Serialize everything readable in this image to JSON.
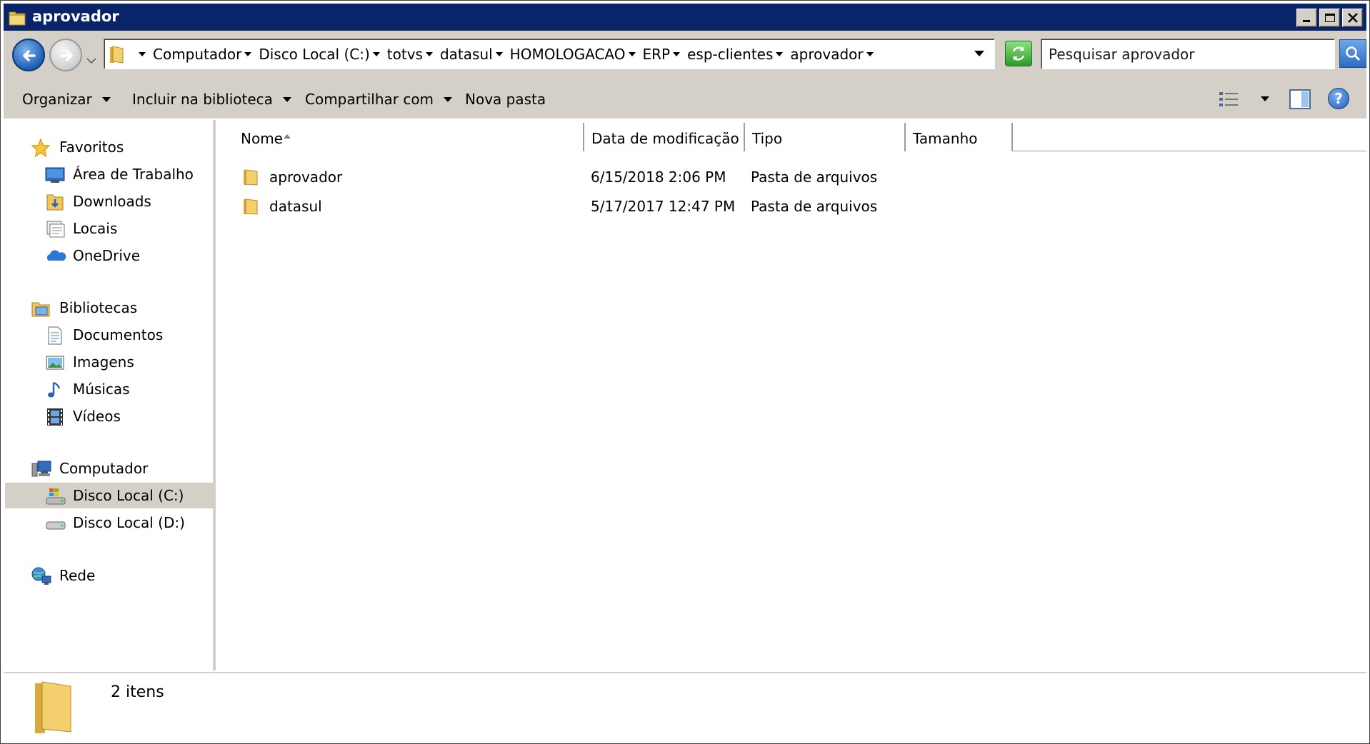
{
  "window": {
    "title": "aprovador"
  },
  "address": {
    "breadcrumbs": [
      "Computador",
      "Disco Local (C:)",
      "totvs",
      "datasul",
      "HOMOLOGACAO",
      "ERP",
      "esp-clientes",
      "aprovador"
    ]
  },
  "search": {
    "placeholder": "Pesquisar aprovador"
  },
  "toolbar": {
    "organize": "Organizar",
    "include_library": "Incluir na biblioteca",
    "share_with": "Compartilhar com",
    "new_folder": "Nova pasta"
  },
  "sidebar": {
    "favorites": {
      "label": "Favoritos",
      "items": [
        {
          "label": "Área de Trabalho",
          "icon": "desktop-icon"
        },
        {
          "label": "Downloads",
          "icon": "downloads-folder-icon"
        },
        {
          "label": "Locais",
          "icon": "recent-places-icon"
        },
        {
          "label": "OneDrive",
          "icon": "onedrive-cloud-icon"
        }
      ]
    },
    "libraries": {
      "label": "Bibliotecas",
      "items": [
        {
          "label": "Documentos",
          "icon": "documents-icon"
        },
        {
          "label": "Imagens",
          "icon": "pictures-icon"
        },
        {
          "label": "Músicas",
          "icon": "music-note-icon"
        },
        {
          "label": "Vídeos",
          "icon": "video-film-icon"
        }
      ]
    },
    "computer": {
      "label": "Computador",
      "items": [
        {
          "label": "Disco Local (C:)",
          "icon": "system-drive-icon",
          "selected": true
        },
        {
          "label": "Disco Local (D:)",
          "icon": "drive-icon"
        }
      ]
    },
    "network": {
      "label": "Rede"
    }
  },
  "columns": {
    "name": "Nome",
    "modified": "Data de modificação",
    "type": "Tipo",
    "size": "Tamanho"
  },
  "files": [
    {
      "name": "aprovador",
      "modified": "6/15/2018 2:06 PM",
      "type": "Pasta de arquivos",
      "size": ""
    },
    {
      "name": "datasul",
      "modified": "5/17/2017 12:47 PM",
      "type": "Pasta de arquivos",
      "size": ""
    }
  ],
  "status": {
    "count": "2 itens"
  },
  "colors": {
    "titlebar": "#0a246a",
    "chrome": "#d4d0c8",
    "selection": "#d4d0c8"
  }
}
